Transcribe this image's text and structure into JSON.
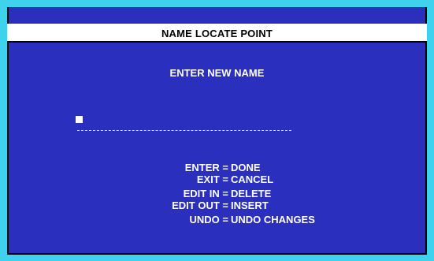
{
  "dialog": {
    "title": "NAME LOCATE POINT",
    "prompt": "ENTER NEW NAME",
    "name_value": ""
  },
  "key_help": [
    {
      "key": "ENTER =",
      "action": "DONE"
    },
    {
      "key": "EXIT =",
      "action": "CANCEL"
    },
    {
      "key": "EDIT IN =",
      "action": "DELETE"
    },
    {
      "key": "EDIT OUT =",
      "action": "INSERT"
    },
    {
      "key": "UNDO =",
      "action": "UNDO CHANGES"
    }
  ],
  "colors": {
    "background": "#2a2fbe",
    "frame": "#3fd2ee",
    "title_bar": "#ffffff",
    "text": "#ffffff"
  }
}
